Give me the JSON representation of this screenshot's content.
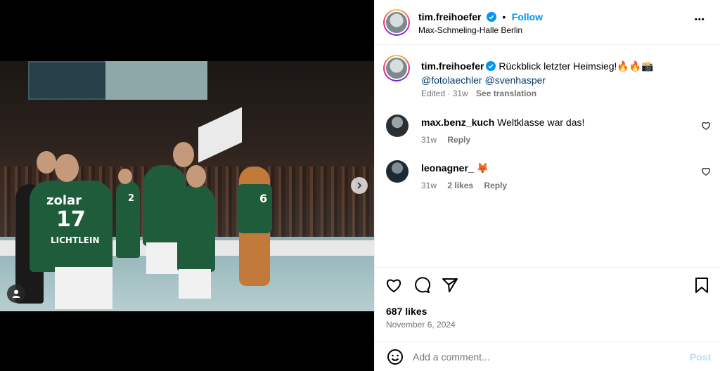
{
  "post": {
    "author": "tim.freihoefer",
    "follow_label": "Follow",
    "separator": "•",
    "location": "Max-Schmeling-Halle Berlin",
    "more_label": "•••",
    "caption": {
      "author": "tim.freihoefer",
      "text": "Rückblick letzter Heimsieg!🔥🔥📸",
      "mention1": "@fotolaechler",
      "mention2": "@svenhasper",
      "meta_time": "Edited · 31w",
      "see_translation": "See translation"
    },
    "photo": {
      "jersey_number_main": "17",
      "jersey_sponsor": "zolar",
      "jersey_name": "LICHTLEIN",
      "jersey_number_mascot": "6",
      "jersey_number_back": "2"
    },
    "likes": "687 likes",
    "date": "November 6, 2024"
  },
  "comments": [
    {
      "user": "max.benz_kuch",
      "text": "Weltklasse war das!",
      "time": "31w",
      "likes": "",
      "reply": "Reply"
    },
    {
      "user": "leonagner_",
      "text": "🦊",
      "time": "31w",
      "likes": "2 likes",
      "reply": "Reply"
    }
  ],
  "composer": {
    "placeholder": "Add a comment...",
    "post_label": "Post"
  },
  "colors": {
    "accent": "#0095f6",
    "link": "#00376b",
    "muted": "#737373",
    "border": "#efefef"
  },
  "icons": {
    "like": "heart-icon",
    "comment": "speech-bubble-icon",
    "share": "paper-plane-icon",
    "save": "bookmark-icon",
    "emoji": "smiley-icon",
    "next": "chevron-right-icon",
    "tags": "user-tag-icon"
  }
}
